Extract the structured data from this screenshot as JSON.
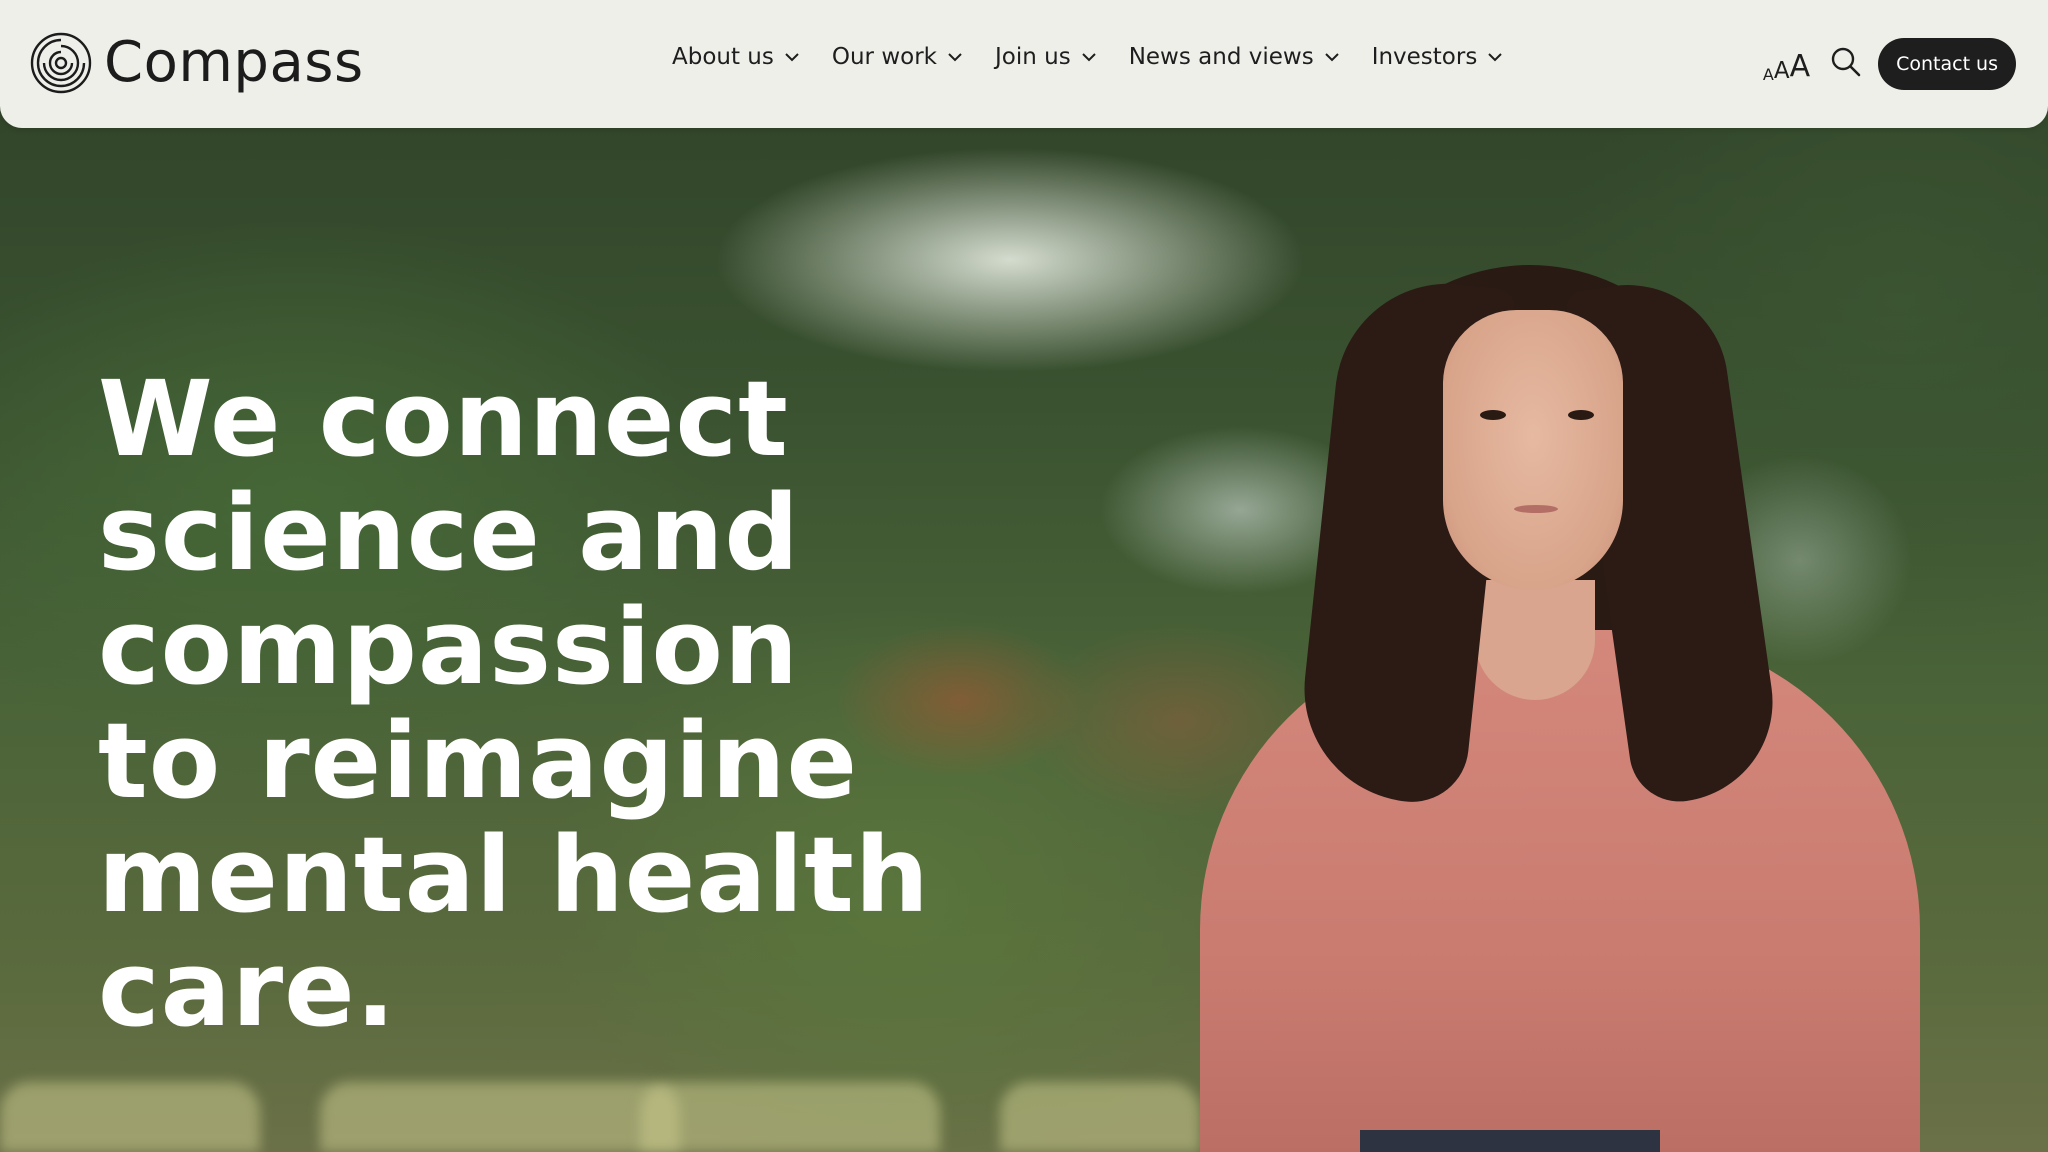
{
  "brand": {
    "name": "Compass",
    "icon": "compass-rings-logo"
  },
  "nav": {
    "items": [
      {
        "label": "About us",
        "icon": "chevron-down-icon"
      },
      {
        "label": "Our work",
        "icon": "chevron-down-icon"
      },
      {
        "label": "Join us",
        "icon": "chevron-down-icon"
      },
      {
        "label": "News and views",
        "icon": "chevron-down-icon"
      },
      {
        "label": "Investors",
        "icon": "chevron-down-icon"
      }
    ]
  },
  "tools": {
    "text_size": {
      "small": "A",
      "medium": "A",
      "large": "A"
    },
    "search_icon": "search-icon",
    "contact_label": "Contact us"
  },
  "hero": {
    "headline": "We connect science and compassion to reimagine mental health care."
  },
  "colors": {
    "header_bg": "#efefea",
    "text_dark": "#1e1e1e",
    "button_bg": "#1e1e1e",
    "button_text": "#ffffff",
    "headline_text": "#ffffff",
    "shirt": "#d4877b"
  }
}
